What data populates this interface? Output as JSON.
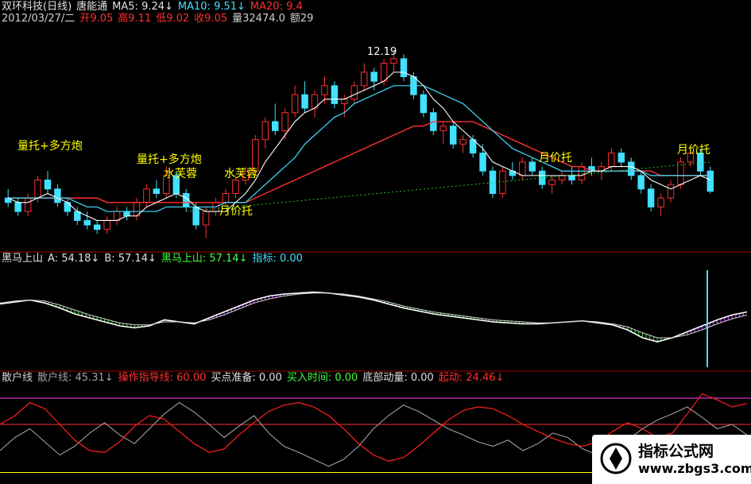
{
  "header": {
    "line1": [
      {
        "text": "双环科技(日线)",
        "color": "#e0e0e0"
      },
      {
        "text": "唐能通",
        "color": "#e0e0e0"
      },
      {
        "text": "MA5: 9.24↓",
        "color": "#e0e0e0"
      },
      {
        "text": "MA10: 9.51↓",
        "color": "#40e0ff"
      },
      {
        "text": "MA20: 9.4",
        "color": "#ff3030"
      }
    ],
    "line2": [
      {
        "text": "2012/03/27/二",
        "color": "#d0d0d0"
      },
      {
        "text": "开9.05",
        "color": "#ff3030"
      },
      {
        "text": "高9.11",
        "color": "#ff3030"
      },
      {
        "text": "低9.02",
        "color": "#ff3030"
      },
      {
        "text": "收9.05",
        "color": "#ff3030"
      },
      {
        "text": "量32474.0",
        "color": "#d0d0d0"
      },
      {
        "text": "额29",
        "color": "#d0d0d0"
      }
    ]
  },
  "annotations": [
    {
      "text": "量托+多方炮",
      "color": "#ffff00"
    },
    {
      "text": "量托+多方炮",
      "color": "#ffff00"
    },
    {
      "text": "水芙蓉",
      "color": "#ffff00"
    },
    {
      "text": "水芙蓉",
      "color": "#ffff00"
    },
    {
      "text": "月价托",
      "color": "#ffff00"
    },
    {
      "text": "月价托",
      "color": "#ffff00"
    },
    {
      "text": "月价托",
      "color": "#ffff00"
    },
    {
      "text": "12.19",
      "color": "#ffffff"
    }
  ],
  "panel2_header": [
    {
      "text": "黑马上山",
      "color": "#e0e0e0"
    },
    {
      "text": "A: 54.18↓",
      "color": "#e0e0e0"
    },
    {
      "text": "B: 57.14↓",
      "color": "#e0e0e0"
    },
    {
      "text": "黑马上山: 57.14↓",
      "color": "#40ff40"
    },
    {
      "text": "指标: 0.00",
      "color": "#40e0ff"
    }
  ],
  "panel3_header": [
    {
      "text": "散户线",
      "color": "#d0d0d0"
    },
    {
      "text": "散户线: 45.31↓",
      "color": "#a0a0a0"
    },
    {
      "text": "操作指导线: 60.00",
      "color": "#ff3030"
    },
    {
      "text": "买点准备: 0.00",
      "color": "#e0e0e0"
    },
    {
      "text": "买入时间: 0.00",
      "color": "#40ff40"
    },
    {
      "text": "底部动量: 0.00",
      "color": "#e0e0e0"
    },
    {
      "text": "起动: 24.46↓",
      "color": "#ff3030"
    }
  ],
  "watermark": {
    "line1": "指标公式网",
    "line2": "www.zbgs3.com"
  },
  "colors": {
    "up": "#ff3030",
    "down": "#40e0ff",
    "ma10": "#40e0ff",
    "ma20": "#ff3030",
    "ma5": "#ffffff",
    "grid_magenta": "#ff40ff",
    "guide": "#ff3030"
  },
  "chart_data": [
    {
      "type": "candlestick",
      "title": "双环科技(日线)",
      "ylim": [
        8.0,
        12.6
      ],
      "ohlc": [
        [
          8.9,
          9.1,
          8.7,
          8.8
        ],
        [
          8.8,
          8.9,
          8.5,
          8.6
        ],
        [
          8.6,
          9.0,
          8.5,
          8.9
        ],
        [
          8.9,
          9.4,
          8.8,
          9.3
        ],
        [
          9.3,
          9.5,
          9.0,
          9.1
        ],
        [
          9.1,
          9.2,
          8.7,
          8.8
        ],
        [
          8.8,
          8.9,
          8.5,
          8.6
        ],
        [
          8.6,
          8.7,
          8.3,
          8.4
        ],
        [
          8.4,
          8.6,
          8.2,
          8.3
        ],
        [
          8.3,
          8.4,
          8.1,
          8.2
        ],
        [
          8.2,
          8.5,
          8.1,
          8.4
        ],
        [
          8.4,
          8.7,
          8.3,
          8.6
        ],
        [
          8.6,
          8.7,
          8.4,
          8.5
        ],
        [
          8.5,
          8.9,
          8.4,
          8.8
        ],
        [
          8.8,
          9.2,
          8.7,
          9.1
        ],
        [
          9.1,
          9.3,
          8.9,
          9.0
        ],
        [
          9.0,
          9.6,
          8.9,
          9.4
        ],
        [
          9.4,
          9.5,
          8.9,
          9.0
        ],
        [
          9.0,
          9.1,
          8.6,
          8.7
        ],
        [
          8.7,
          8.8,
          8.2,
          8.3
        ],
        [
          8.3,
          8.7,
          8.0,
          8.6
        ],
        [
          8.6,
          8.9,
          8.5,
          8.8
        ],
        [
          8.8,
          9.1,
          8.7,
          9.0
        ],
        [
          9.0,
          9.4,
          8.9,
          9.3
        ],
        [
          9.3,
          9.6,
          9.2,
          9.5
        ],
        [
          9.5,
          10.3,
          9.4,
          10.2
        ],
        [
          10.2,
          10.7,
          10.0,
          10.6
        ],
        [
          10.6,
          11.0,
          10.3,
          10.4
        ],
        [
          10.4,
          10.9,
          10.2,
          10.8
        ],
        [
          10.8,
          11.4,
          10.7,
          11.2
        ],
        [
          11.2,
          11.5,
          10.8,
          10.9
        ],
        [
          10.9,
          11.3,
          10.7,
          11.2
        ],
        [
          11.2,
          11.6,
          11.0,
          11.4
        ],
        [
          11.4,
          11.5,
          10.9,
          11.0
        ],
        [
          11.0,
          11.2,
          10.7,
          11.1
        ],
        [
          11.1,
          11.5,
          11.0,
          11.4
        ],
        [
          11.4,
          11.9,
          11.3,
          11.7
        ],
        [
          11.7,
          11.8,
          11.3,
          11.5
        ],
        [
          11.5,
          12.0,
          11.4,
          11.9
        ],
        [
          11.9,
          12.19,
          11.7,
          12.0
        ],
        [
          12.0,
          12.1,
          11.5,
          11.6
        ],
        [
          11.6,
          11.7,
          11.1,
          11.2
        ],
        [
          11.2,
          11.3,
          10.7,
          10.8
        ],
        [
          10.8,
          10.9,
          10.3,
          10.4
        ],
        [
          10.4,
          10.6,
          10.1,
          10.5
        ],
        [
          10.5,
          10.6,
          10.0,
          10.1
        ],
        [
          10.1,
          10.3,
          9.9,
          10.2
        ],
        [
          10.2,
          10.3,
          9.8,
          9.9
        ],
        [
          9.9,
          10.1,
          9.4,
          9.5
        ],
        [
          9.5,
          9.6,
          8.9,
          9.0
        ],
        [
          9.0,
          9.6,
          8.9,
          9.5
        ],
        [
          9.5,
          9.7,
          9.3,
          9.4
        ],
        [
          9.4,
          9.8,
          9.3,
          9.7
        ],
        [
          9.7,
          9.8,
          9.4,
          9.5
        ],
        [
          9.5,
          9.6,
          9.1,
          9.2
        ],
        [
          9.2,
          9.4,
          9.0,
          9.3
        ],
        [
          9.3,
          9.5,
          9.2,
          9.4
        ],
        [
          9.4,
          9.6,
          9.2,
          9.3
        ],
        [
          9.3,
          9.7,
          9.2,
          9.6
        ],
        [
          9.6,
          9.8,
          9.4,
          9.5
        ],
        [
          9.5,
          9.7,
          9.3,
          9.6
        ],
        [
          9.6,
          10.0,
          9.5,
          9.9
        ],
        [
          9.9,
          10.0,
          9.6,
          9.7
        ],
        [
          9.7,
          9.8,
          9.3,
          9.4
        ],
        [
          9.4,
          9.5,
          9.0,
          9.1
        ],
        [
          9.1,
          9.2,
          8.6,
          8.7
        ],
        [
          8.7,
          9.0,
          8.5,
          8.9
        ],
        [
          8.9,
          9.3,
          8.8,
          9.2
        ],
        [
          9.2,
          9.8,
          9.1,
          9.7
        ],
        [
          9.7,
          10.0,
          9.6,
          9.9
        ],
        [
          9.9,
          10.0,
          9.4,
          9.5
        ],
        [
          9.5,
          9.6,
          9.0,
          9.05
        ]
      ],
      "ma5": [
        8.9,
        8.8,
        8.8,
        8.9,
        9.0,
        8.9,
        8.8,
        8.6,
        8.5,
        8.4,
        8.4,
        8.4,
        8.5,
        8.5,
        8.7,
        8.8,
        8.9,
        9.0,
        8.9,
        8.7,
        8.6,
        8.6,
        8.6,
        8.8,
        9.0,
        9.3,
        9.7,
        10.0,
        10.3,
        10.6,
        10.8,
        10.9,
        11.1,
        11.1,
        11.1,
        11.2,
        11.3,
        11.4,
        11.5,
        11.7,
        11.7,
        11.6,
        11.4,
        11.1,
        10.9,
        10.6,
        10.4,
        10.2,
        10.0,
        9.7,
        9.6,
        9.5,
        9.4,
        9.4,
        9.4,
        9.4,
        9.4,
        9.4,
        9.4,
        9.5,
        9.5,
        9.6,
        9.6,
        9.6,
        9.5,
        9.3,
        9.2,
        9.1,
        9.2,
        9.3,
        9.4,
        9.3
      ],
      "ma10": [
        8.9,
        8.9,
        8.9,
        8.9,
        8.9,
        8.9,
        8.9,
        8.8,
        8.7,
        8.7,
        8.6,
        8.6,
        8.6,
        8.6,
        8.6,
        8.6,
        8.7,
        8.7,
        8.7,
        8.7,
        8.7,
        8.7,
        8.8,
        8.8,
        8.8,
        9.0,
        9.2,
        9.4,
        9.6,
        9.8,
        10.1,
        10.3,
        10.5,
        10.7,
        10.8,
        11.0,
        11.1,
        11.2,
        11.3,
        11.4,
        11.4,
        11.4,
        11.4,
        11.3,
        11.2,
        11.1,
        11.0,
        10.8,
        10.6,
        10.4,
        10.2,
        10.0,
        9.9,
        9.8,
        9.7,
        9.6,
        9.5,
        9.5,
        9.5,
        9.5,
        9.5,
        9.5,
        9.5,
        9.5,
        9.5,
        9.4,
        9.4,
        9.4,
        9.4,
        9.4,
        9.4,
        9.4
      ],
      "ma20": [
        8.9,
        8.9,
        8.9,
        8.9,
        8.9,
        8.9,
        8.9,
        8.9,
        8.9,
        8.9,
        8.8,
        8.8,
        8.8,
        8.8,
        8.8,
        8.8,
        8.8,
        8.8,
        8.8,
        8.8,
        8.8,
        8.8,
        8.8,
        8.8,
        8.8,
        8.9,
        9.0,
        9.1,
        9.2,
        9.3,
        9.4,
        9.5,
        9.6,
        9.7,
        9.8,
        9.9,
        10.0,
        10.1,
        10.2,
        10.3,
        10.4,
        10.5,
        10.5,
        10.6,
        10.6,
        10.6,
        10.6,
        10.6,
        10.5,
        10.4,
        10.3,
        10.2,
        10.1,
        10.0,
        9.9,
        9.8,
        9.7,
        9.6,
        9.6,
        9.5,
        9.5,
        9.5,
        9.5,
        9.5,
        9.5,
        9.5,
        9.4,
        9.4,
        9.4,
        9.4,
        9.4,
        9.4
      ]
    },
    {
      "type": "line",
      "title": "黑马上山",
      "ylim": [
        0,
        100
      ],
      "series": [
        {
          "name": "A",
          "values": [
            62,
            64,
            66,
            63,
            58,
            52,
            48,
            44,
            40,
            38,
            40,
            46,
            44,
            42,
            48,
            54,
            60,
            66,
            70,
            72,
            73,
            74,
            73,
            71,
            69,
            66,
            62,
            58,
            55,
            52,
            50,
            48,
            46,
            44,
            43,
            42,
            42,
            43,
            44,
            45,
            43,
            41,
            36,
            28,
            24,
            28,
            34,
            40,
            46,
            51,
            54
          ]
        },
        {
          "name": "B",
          "values": [
            63,
            65,
            66,
            65,
            61,
            56,
            51,
            47,
            43,
            41,
            41,
            44,
            44,
            43,
            46,
            51,
            57,
            63,
            67,
            70,
            72,
            73,
            73,
            72,
            70,
            67,
            64,
            60,
            57,
            54,
            52,
            50,
            48,
            46,
            45,
            44,
            43,
            43,
            44,
            45,
            44,
            42,
            39,
            33,
            28,
            28,
            31,
            36,
            42,
            47,
            51
          ]
        }
      ]
    },
    {
      "type": "line",
      "title": "散户线",
      "ylim": [
        0,
        100
      ],
      "series": [
        {
          "name": "散户线",
          "values": [
            30,
            45,
            55,
            40,
            25,
            35,
            50,
            62,
            48,
            38,
            55,
            72,
            85,
            74,
            60,
            45,
            58,
            70,
            50,
            35,
            28,
            20,
            12,
            20,
            35,
            55,
            70,
            82,
            75,
            65,
            55,
            48,
            40,
            35,
            42,
            30,
            38,
            50,
            45,
            32,
            25,
            30,
            42,
            55,
            65,
            72,
            80,
            68,
            55,
            60,
            48
          ]
        },
        {
          "name": "起动",
          "values": [
            60,
            70,
            85,
            78,
            60,
            42,
            30,
            28,
            40,
            58,
            70,
            66,
            52,
            38,
            28,
            32,
            48,
            62,
            75,
            82,
            85,
            80,
            70,
            55,
            38,
            25,
            18,
            22,
            35,
            50,
            65,
            76,
            80,
            78,
            70,
            60,
            52,
            44,
            38,
            35,
            40,
            52,
            62,
            55,
            45,
            50,
            72,
            95,
            88,
            80,
            84
          ]
        }
      ]
    }
  ]
}
